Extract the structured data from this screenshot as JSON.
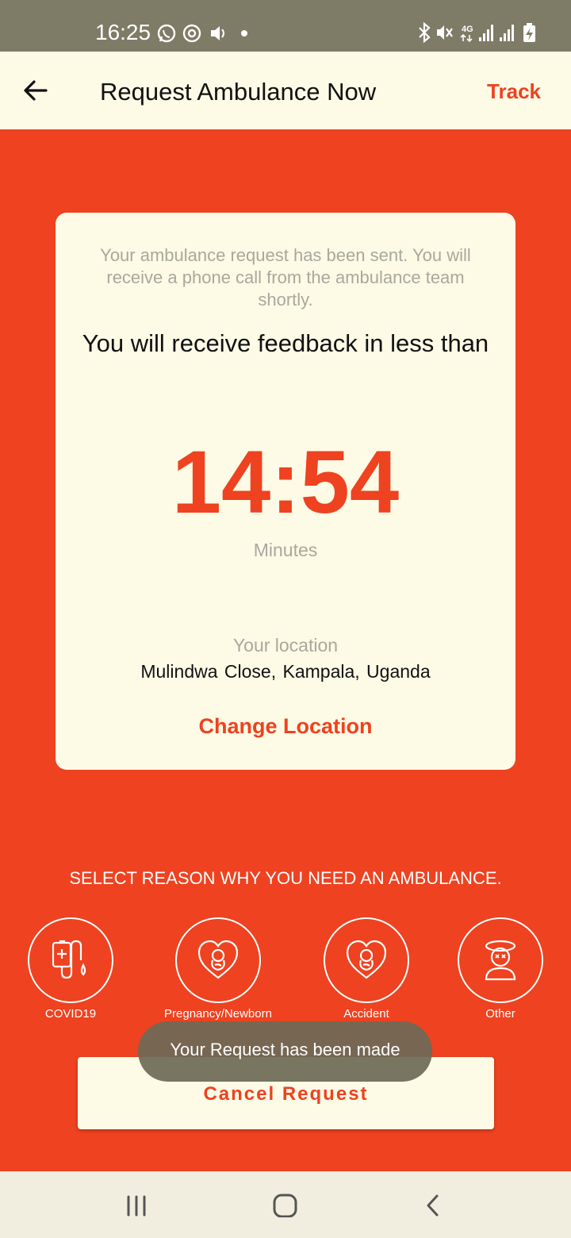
{
  "status_bar": {
    "time": "16:25",
    "left_icons": [
      "whatsapp-icon",
      "sync-icon",
      "volume-icon",
      "dot-icon"
    ],
    "right_icons": [
      "bluetooth-icon",
      "mute-icon",
      "network-4g-icon",
      "signal-icon",
      "signal-icon",
      "battery-charging-icon"
    ]
  },
  "app_bar": {
    "back_icon": "arrow-left-icon",
    "title": "Request Ambulance Now",
    "track_label": "Track"
  },
  "card": {
    "sent_message": "Your ambulance request has been sent. You will receive a phone call from the ambulance team shortly.",
    "feedback_text": "You will receive feedback in less than",
    "timer": "14:54",
    "timer_unit": "Minutes",
    "location_label": "Your location",
    "location_value": "Mulindwa Close,  Kampala,  Uganda",
    "change_location_label": "Change Location"
  },
  "reasons": {
    "heading": "SELECT REASON WHY YOU NEED AN AMBULANCE.",
    "items": [
      {
        "label": "COVID19",
        "icon": "covid-drip-icon"
      },
      {
        "label": "Pregnancy/Newborn",
        "icon": "baby-heart-icon"
      },
      {
        "label": "Accident",
        "icon": "baby-heart-icon"
      },
      {
        "label": "Other",
        "icon": "dizzy-person-icon"
      }
    ]
  },
  "cancel_button_label": "Cancel Request",
  "toast": "Your Request has been made",
  "nav_bar": {
    "buttons": [
      "recent-apps-icon",
      "home-icon",
      "back-icon"
    ]
  },
  "colors": {
    "accent": "#ee4220",
    "surface": "#fdfbe6",
    "status_bar": "#7e7b67",
    "muted_text": "#a9a89d"
  }
}
